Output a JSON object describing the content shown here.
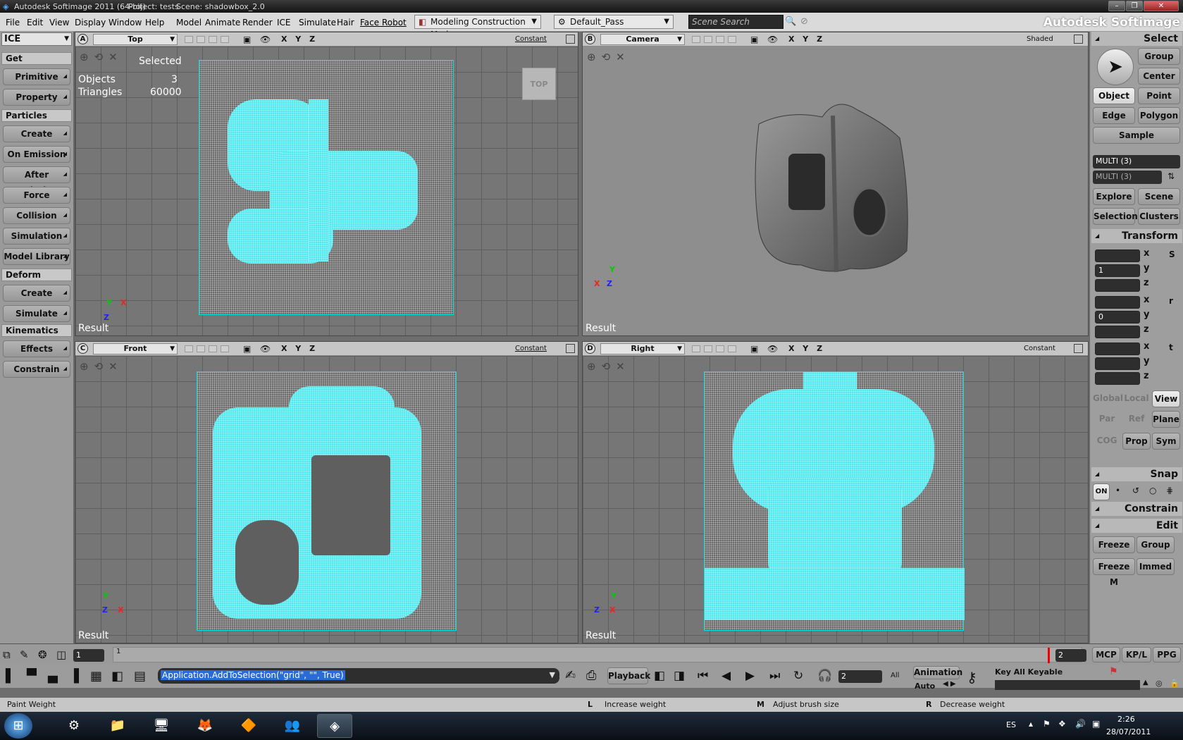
{
  "window": {
    "title": "Autodesk Softimage 2011 (64-bit)",
    "project": "Project: tests",
    "scene": "Scene: shadowbox_2.0"
  },
  "menu": {
    "items": [
      "File",
      "Edit",
      "View",
      "Display",
      "Window",
      "Help",
      "Model",
      "Animate",
      "Render",
      "ICE",
      "Simulate",
      "Hair",
      "Face Robot"
    ],
    "mode": "Modeling Construction Mode",
    "pass": "Default_Pass",
    "search_placeholder": "Scene Search",
    "brand": "Autodesk Softimage"
  },
  "left_panel": {
    "module": "ICE",
    "sections": [
      {
        "title": "Get",
        "buttons": [
          "Primitive",
          "Property"
        ]
      },
      {
        "title": "Particles",
        "buttons": [
          "Create",
          "On Emission",
          "After Emission",
          "Force",
          "Collision",
          "Simulation",
          "Model Library"
        ]
      },
      {
        "title": "Deform",
        "buttons": [
          "Create",
          "Simulate"
        ]
      },
      {
        "title": "Kinematics",
        "buttons": [
          "Effects",
          "Constrain"
        ]
      }
    ]
  },
  "viewports": {
    "a": {
      "letter": "A",
      "view": "Top",
      "mode": "Constant",
      "result": "Result",
      "stats": {
        "selected": "Selected",
        "objects_label": "Objects",
        "objects": "3",
        "triangles_label": "Triangles",
        "triangles": "60000"
      },
      "cube": "TOP"
    },
    "b": {
      "letter": "B",
      "view": "Camera",
      "mode": "Shaded",
      "result": "Result"
    },
    "c": {
      "letter": "C",
      "view": "Front",
      "mode": "Constant",
      "result": "Result"
    },
    "d": {
      "letter": "D",
      "view": "Right",
      "mode": "Constant",
      "result": "Result"
    },
    "xyz": "X Y Z",
    "axis": {
      "x": "X",
      "y": "Y",
      "z": "Z"
    }
  },
  "right_panel": {
    "select": {
      "title": "Select",
      "group": "Group",
      "center": "Center",
      "object": "Object",
      "point": "Point",
      "edge": "Edge",
      "polygon": "Polygon",
      "sample": "Sample",
      "multi1": "MULTI (3)",
      "multi2": "MULTI (3)",
      "explore": "Explore",
      "scene": "Scene",
      "selection": "Selection",
      "clusters": "Clusters"
    },
    "transform": {
      "title": "Transform",
      "scale_y": "1",
      "rot_y": "0",
      "x": "x",
      "y": "y",
      "z": "z",
      "global": "Global",
      "local": "Local",
      "view": "View",
      "par": "Par",
      "ref": "Ref",
      "plane": "Plane",
      "cog": "COG",
      "prop": "Prop",
      "sym": "Sym"
    },
    "snap": {
      "title": "Snap",
      "on": "ON"
    },
    "constrain": {
      "title": "Constrain"
    },
    "edit": {
      "title": "Edit",
      "freeze": "Freeze",
      "group": "Group",
      "freeze_m": "Freeze M",
      "immed": "Immed"
    }
  },
  "timeline": {
    "start": "1",
    "tick": "1",
    "current": "2",
    "mcp": "MCP",
    "kpl": "KP/L",
    "ppg": "PPG"
  },
  "command": {
    "text": "Application.AddToSelection(\"grid\", \"\", True)",
    "playback": "Playback",
    "frame": "2",
    "all": "All",
    "animation": "Animation",
    "auto": "Auto",
    "key_all": "Key All Keyable"
  },
  "status": {
    "left": "Paint Weight",
    "l_key": "L",
    "l_text": "Increase weight",
    "m_key": "M",
    "m_text": "Adjust brush size",
    "r_key": "R",
    "r_text": "Decrease weight"
  },
  "taskbar": {
    "lang": "ES",
    "time": "2:26",
    "date": "28/07/2011"
  }
}
